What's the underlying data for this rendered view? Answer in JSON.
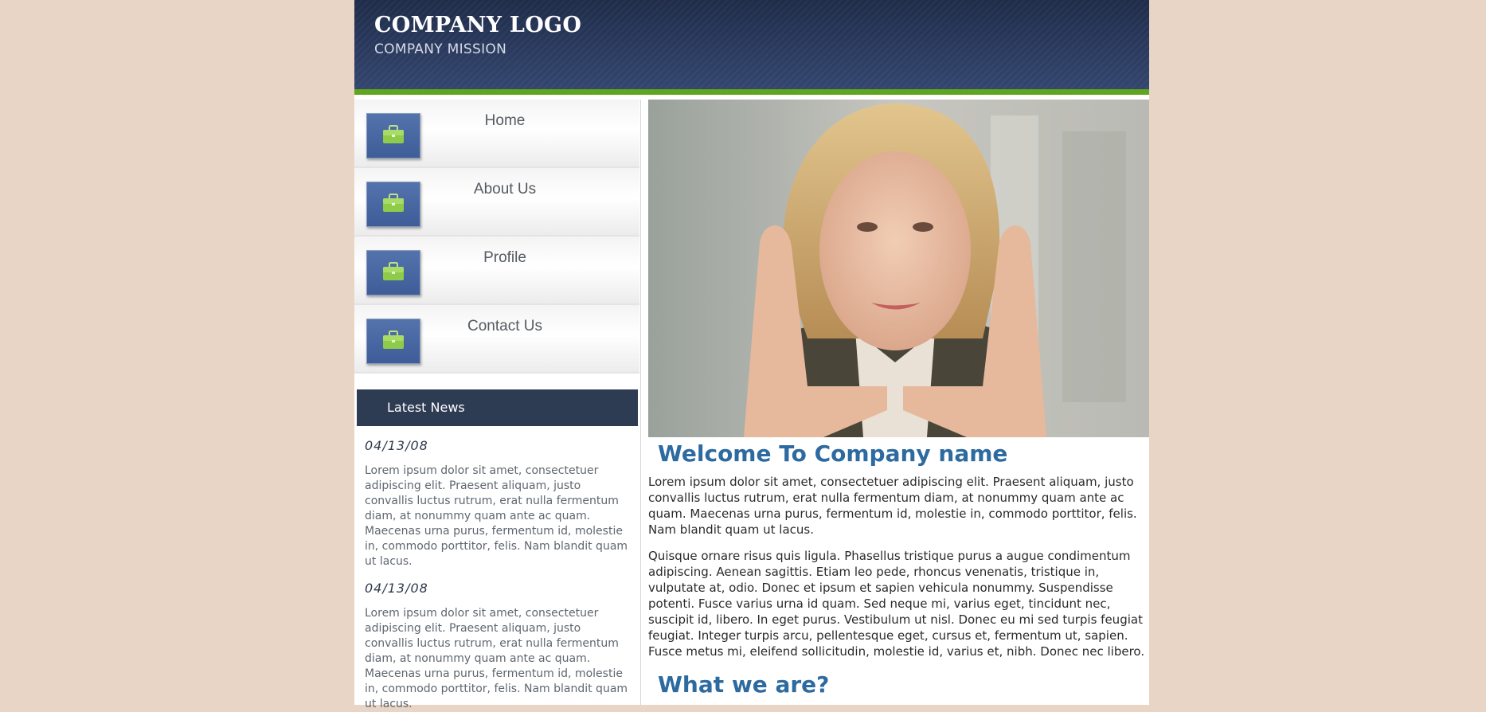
{
  "header": {
    "logo": "COMPANY LOGO",
    "mission": "COMPANY MISSION"
  },
  "nav": {
    "items": [
      {
        "label": "Home",
        "icon": "briefcase-icon"
      },
      {
        "label": "About Us",
        "icon": "briefcase-icon"
      },
      {
        "label": "Profile",
        "icon": "briefcase-icon"
      },
      {
        "label": "Contact Us",
        "icon": "briefcase-icon"
      }
    ]
  },
  "news": {
    "title": "Latest News",
    "items": [
      {
        "date": "04/13/08",
        "text": "Lorem ipsum dolor sit amet, consectetuer adipiscing elit. Praesent aliquam, justo convallis luctus rutrum, erat nulla fermentum diam, at nonummy quam ante ac quam. Maecenas urna purus, fermentum id, molestie in, commodo porttitor, felis. Nam blandit quam ut lacus."
      },
      {
        "date": "04/13/08",
        "text": "Lorem ipsum dolor sit amet, consectetuer adipiscing elit. Praesent aliquam, justo convallis luctus rutrum, erat nulla fermentum diam, at nonummy quam ante ac quam. Maecenas urna purus, fermentum id, molestie in, commodo porttitor, felis. Nam blandit quam ut lacus."
      }
    ]
  },
  "main": {
    "welcome_heading": "Welcome To Company name",
    "welcome_para1": "Lorem ipsum dolor sit amet, consectetuer adipiscing elit. Praesent aliquam, justo convallis luctus rutrum, erat nulla fermentum diam, at nonummy quam ante ac quam. Maecenas urna purus, fermentum id, molestie in, commodo porttitor, felis. Nam blandit quam ut lacus.",
    "welcome_para2": "Quisque ornare risus quis ligula. Phasellus tristique purus a augue condimentum adipiscing. Aenean sagittis. Etiam leo pede, rhoncus venenatis, tristique in, vulputate at, odio. Donec et ipsum et sapien vehicula nonummy. Suspendisse potenti. Fusce varius urna id quam. Sed neque mi, varius eget, tincidunt nec, suscipit id, libero. In eget purus. Vestibulum ut nisl. Donec eu mi sed turpis feugiat feugiat. Integer turpis arcu, pellentesque eget, cursus et, fermentum ut, sapien. Fusce metus mi, eleifend sollicitudin, molestie id, varius et, nibh. Donec nec libero.",
    "second_heading": "What we are?"
  },
  "colors": {
    "page_background": "#e8d5c6",
    "header_background": "#2b3b5f",
    "accent_green": "#5fa51d",
    "heading_blue": "#2d6aa0",
    "news_header": "#2d3b53",
    "nav_icon_blue": "#4a68a3"
  }
}
